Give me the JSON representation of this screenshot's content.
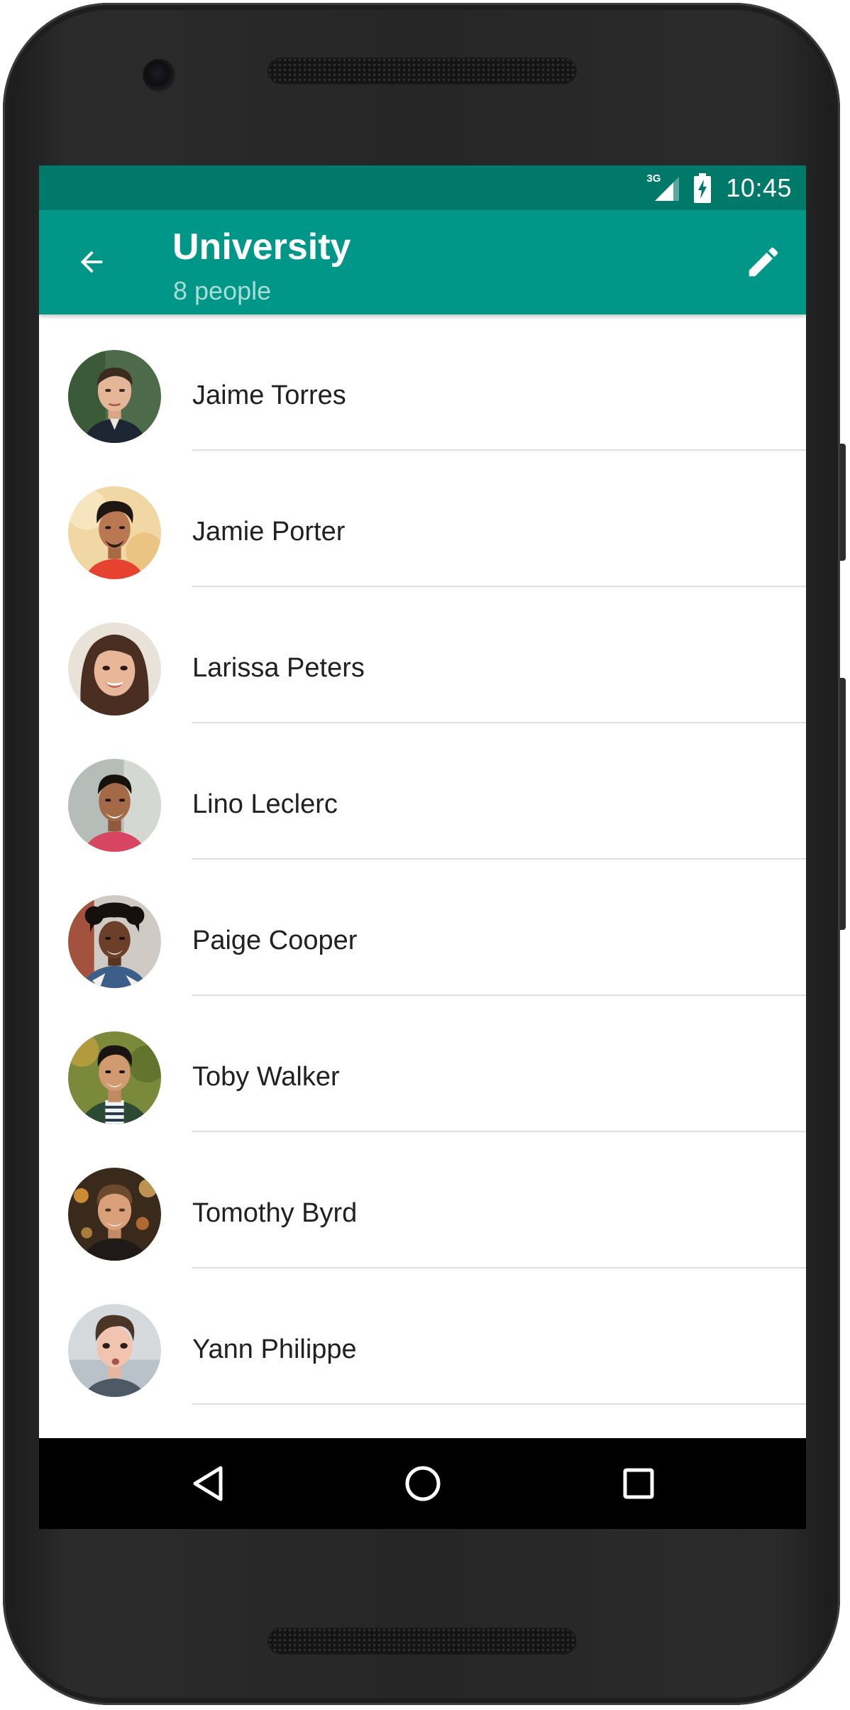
{
  "status_bar": {
    "network_type": "3G",
    "time": "10:45",
    "icons": [
      "signal-icon",
      "battery-charging-icon"
    ]
  },
  "app_bar": {
    "back_icon": "arrow-back-icon",
    "title": "University",
    "subtitle": "8 people",
    "edit_icon": "pencil-icon",
    "background_color": "#009688",
    "status_bar_color": "#00796b"
  },
  "contacts": [
    {
      "name": "Jaime Torres"
    },
    {
      "name": "Jamie Porter"
    },
    {
      "name": "Larissa Peters"
    },
    {
      "name": "Lino Leclerc"
    },
    {
      "name": "Paige Cooper"
    },
    {
      "name": "Toby Walker"
    },
    {
      "name": "Tomothy Byrd"
    },
    {
      "name": "Yann Philippe"
    }
  ],
  "nav_bar": {
    "icons": [
      "nav-back-icon",
      "nav-home-icon",
      "nav-recents-icon"
    ]
  }
}
